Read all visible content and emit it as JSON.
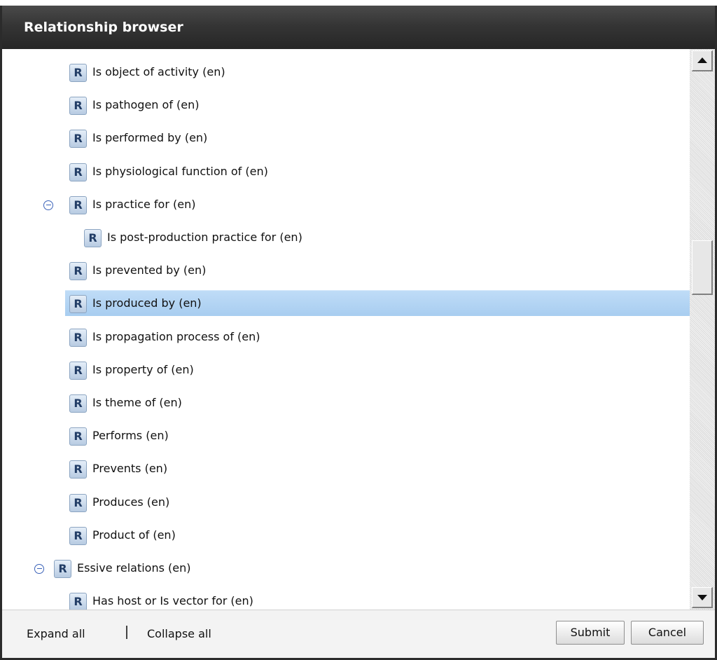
{
  "window": {
    "title": "Relationship browser"
  },
  "badge_letter": "R",
  "tree": [
    {
      "label": "Is object of activity (en)",
      "level": 1
    },
    {
      "label": "Is pathogen of (en)",
      "level": 1
    },
    {
      "label": "Is performed by (en)",
      "level": 1
    },
    {
      "label": "Is physiological function of (en)",
      "level": 1
    },
    {
      "label": "Is practice for (en)",
      "level": 1,
      "expanded": true
    },
    {
      "label": "Is post-production practice for (en)",
      "level": 2
    },
    {
      "label": "Is prevented by (en)",
      "level": 1
    },
    {
      "label": "Is produced by (en)",
      "level": 1,
      "selected": true
    },
    {
      "label": "Is propagation process of (en)",
      "level": 1
    },
    {
      "label": "Is property of (en)",
      "level": 1
    },
    {
      "label": "Is theme of (en)",
      "level": 1
    },
    {
      "label": "Performs (en)",
      "level": 1
    },
    {
      "label": "Prevents (en)",
      "level": 1
    },
    {
      "label": "Produces (en)",
      "level": 1
    },
    {
      "label": "Product of (en)",
      "level": 1
    },
    {
      "label": "Essive relations (en)",
      "level": 0,
      "expanded": true
    },
    {
      "label": "Has host or Is vector for (en)",
      "level": 1
    }
  ],
  "footer": {
    "expand_all": "Expand all",
    "separator": "|",
    "collapse_all": "Collapse all",
    "submit": "Submit",
    "cancel": "Cancel"
  },
  "colors": {
    "titlebar": "#353535",
    "selection": "#b3d4f3",
    "badge": "#c9d9ec",
    "toggle": "#3a62b8"
  }
}
